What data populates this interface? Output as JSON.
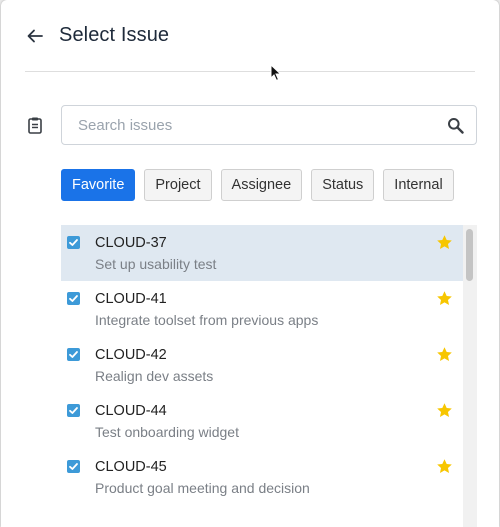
{
  "header": {
    "title": "Select Issue"
  },
  "search": {
    "placeholder": "Search issues",
    "value": ""
  },
  "filters": [
    {
      "label": "Favorite",
      "active": true
    },
    {
      "label": "Project",
      "active": false
    },
    {
      "label": "Assignee",
      "active": false
    },
    {
      "label": "Status",
      "active": false
    },
    {
      "label": "Internal",
      "active": false
    }
  ],
  "issues": [
    {
      "id": "CLOUD-37",
      "description": "Set up usability test",
      "checked": true,
      "favorite": true,
      "selected": true
    },
    {
      "id": "CLOUD-41",
      "description": "Integrate toolset from previous apps",
      "checked": true,
      "favorite": true,
      "selected": false
    },
    {
      "id": "CLOUD-42",
      "description": "Realign dev assets",
      "checked": true,
      "favorite": true,
      "selected": false
    },
    {
      "id": "CLOUD-44",
      "description": "Test onboarding widget",
      "checked": true,
      "favorite": true,
      "selected": false
    },
    {
      "id": "CLOUD-45",
      "description": "Product goal meeting and decision",
      "checked": true,
      "favorite": true,
      "selected": false
    }
  ],
  "colors": {
    "accent": "#1a73e8",
    "checkbox": "#3d9ad8",
    "star": "#f7c600",
    "selected_row": "#dfe8f1"
  },
  "icons": {
    "back": "arrow-left-icon",
    "clipboard": "clipboard-icon",
    "search": "search-icon",
    "checkbox": "checkbox-checked-icon",
    "star": "star-icon"
  }
}
